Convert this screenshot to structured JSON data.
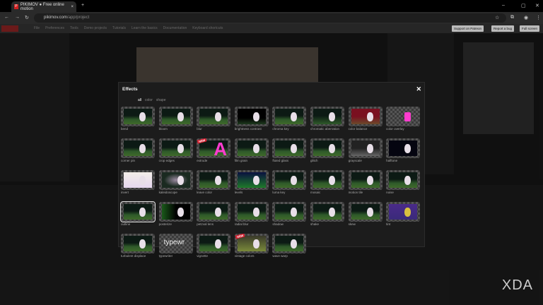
{
  "browser": {
    "tab_title": "PIKIMOV ● Free online motion",
    "url_host": "pikimov.com",
    "url_path": "/app/project"
  },
  "app": {
    "menu": [
      "File",
      "Preferences",
      "Tools",
      "Demo projects",
      "Tutorials",
      "Learn the basics",
      "Documentation",
      "Keyboard shortcuts"
    ],
    "support_label": "Support on Patreon",
    "report_label": "Report a bug",
    "fullscreen_label": "Full screen"
  },
  "effects": {
    "title": "Effects",
    "close": "✕",
    "filters": [
      "all",
      "color",
      "shape"
    ],
    "items": [
      {
        "label": "bend"
      },
      {
        "label": "bloom"
      },
      {
        "label": "blur"
      },
      {
        "label": "brightness contrast"
      },
      {
        "label": "chroma key"
      },
      {
        "label": "chromatic aberration"
      },
      {
        "label": "color balance"
      },
      {
        "label": "color overlay"
      },
      {
        "label": "corner pin"
      },
      {
        "label": "crop edges"
      },
      {
        "label": "extrude",
        "badge": "NEW",
        "text": "A"
      },
      {
        "label": "film grain"
      },
      {
        "label": "fluted glass"
      },
      {
        "label": "glitch"
      },
      {
        "label": "grayscale"
      },
      {
        "label": "halftone"
      },
      {
        "label": "invert"
      },
      {
        "label": "kaleidoscope"
      },
      {
        "label": "leave color"
      },
      {
        "label": "levels"
      },
      {
        "label": "luma key"
      },
      {
        "label": "mosaic"
      },
      {
        "label": "motion tile"
      },
      {
        "label": "noise"
      },
      {
        "label": "outline"
      },
      {
        "label": "posterize"
      },
      {
        "label": "petzval lens"
      },
      {
        "label": "radial blur"
      },
      {
        "label": "shadow"
      },
      {
        "label": "shake"
      },
      {
        "label": "skew"
      },
      {
        "label": "tint"
      },
      {
        "label": "turbulent displace"
      },
      {
        "label": "typewriter",
        "text": "typewr"
      },
      {
        "label": "vignette"
      },
      {
        "label": "vintage colors",
        "badge": "NEW"
      },
      {
        "label": "wave warp"
      }
    ]
  },
  "watermark": "XDA"
}
